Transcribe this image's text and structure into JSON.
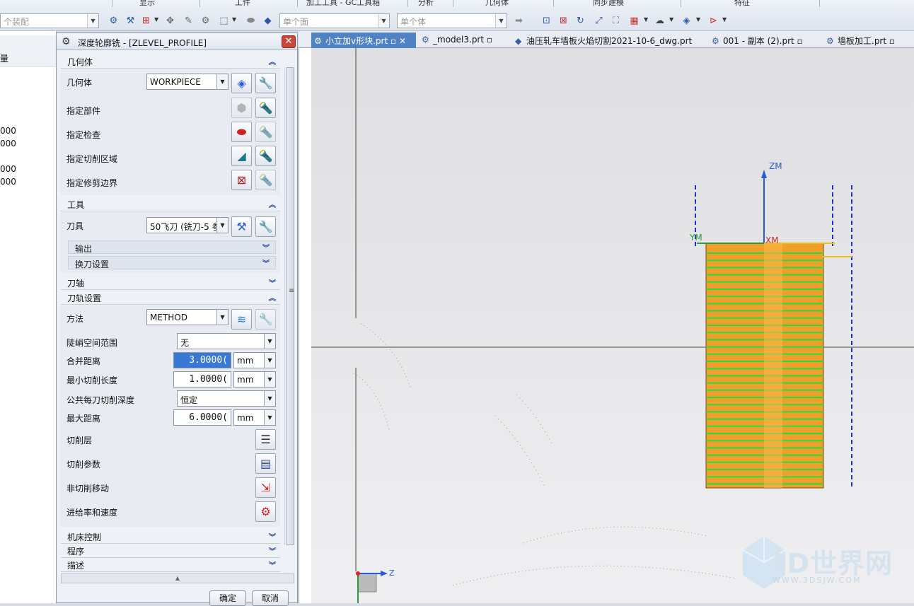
{
  "ribbon": {
    "groups": [
      "显示",
      "工件",
      "加工工具 - GC工具箱",
      "分析",
      "几何体",
      "同步建模",
      "特征"
    ]
  },
  "toolbar": {
    "assembly_combo": "个装配",
    "face_combo": "单个面",
    "body_combo": "单个体"
  },
  "left_panel": {
    "header": "量",
    "values": [
      "000",
      "000",
      "000",
      "000"
    ]
  },
  "dialog": {
    "title": "深度轮廓铣 - [ZLEVEL_PROFILE]",
    "geometry_section": {
      "title": "几何体",
      "geometry_label": "几何体",
      "geometry_value": "WORKPIECE",
      "specify_part": "指定部件",
      "specify_check": "指定检查",
      "specify_cut_area": "指定切削区域",
      "specify_trim": "指定修剪边界"
    },
    "tool_section": {
      "title": "工具",
      "tool_label": "刀具",
      "tool_value": "50飞刀 (铣刀-5 参",
      "output": "输出",
      "tool_change": "换刀设置"
    },
    "tool_axis_section": {
      "title": "刀轴"
    },
    "path_section": {
      "title": "刀轨设置",
      "method_label": "方法",
      "method_value": "METHOD",
      "steep_label": "陡峭空间范围",
      "steep_value": "无",
      "merge_label": "合并距离",
      "merge_value": "3.0000(",
      "merge_unit": "mm",
      "min_cut_label": "最小切削长度",
      "min_cut_value": "1.0000(",
      "min_cut_unit": "mm",
      "depth_label": "公共每刀切削深度",
      "depth_value": "恒定",
      "max_dist_label": "最大距离",
      "max_dist_value": "6.0000(",
      "max_dist_unit": "mm",
      "cut_levels": "切削层",
      "cut_params": "切削参数",
      "non_cut_moves": "非切削移动",
      "feeds_speeds": "进给率和速度"
    },
    "machine_section": {
      "title": "机床控制"
    },
    "program_section": {
      "title": "程序"
    },
    "description_section": {
      "title": "描述"
    },
    "ok": "确定",
    "cancel": "取消"
  },
  "tabs": [
    {
      "label": "小立加v形块.prt",
      "active": true
    },
    {
      "label": "_model3.prt",
      "active": false
    },
    {
      "label": "油压轧车墙板火焰切割2021-10-6_dwg.prt",
      "active": false
    },
    {
      "label": "001 - 副本 (2).prt",
      "active": false
    },
    {
      "label": "墙板加工.prt",
      "active": false
    }
  ],
  "viewport": {
    "wcs": {
      "zm": "ZM",
      "ym": "YM",
      "xm": "XM"
    },
    "triad_z": "Z",
    "colors": {
      "part": "#f0a02a",
      "toolpath": "#22dd44",
      "boundary": "#1f2fd6",
      "wcs": "#2a5bd7"
    }
  },
  "watermark": {
    "text": "3D世界网",
    "url": "WWW.3DSJW.COM"
  }
}
